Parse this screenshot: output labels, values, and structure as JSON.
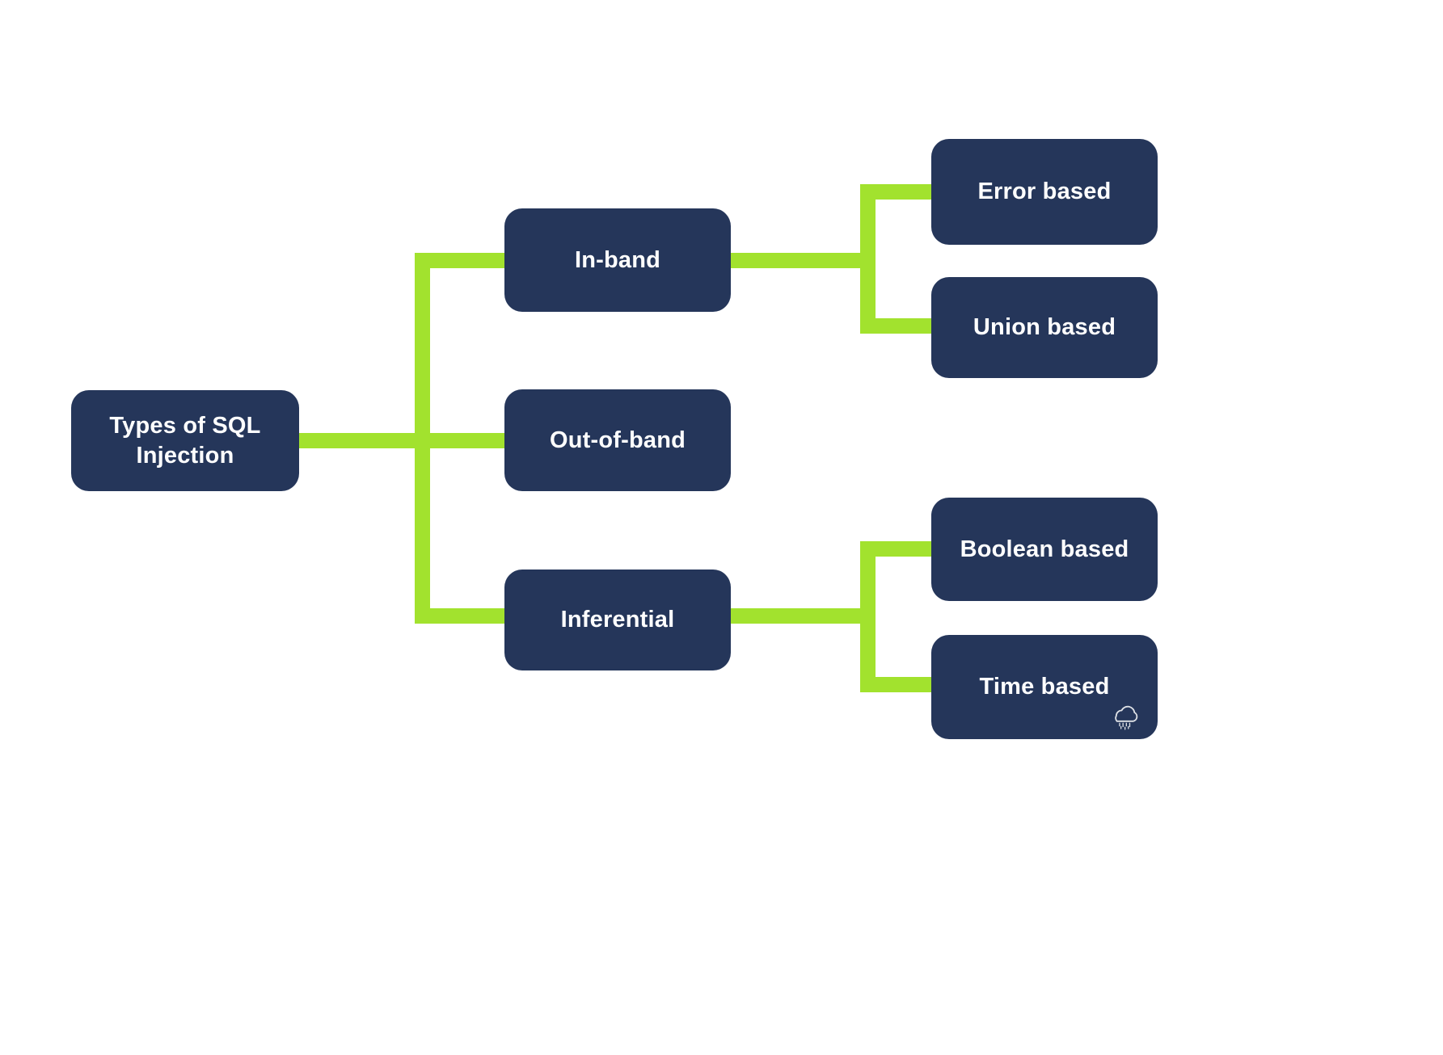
{
  "diagram": {
    "type": "tree-mindmap",
    "orientation": "left-to-right",
    "colors": {
      "node_fill": "#25365a",
      "node_text": "#ffffff",
      "connector": "#a2e22e",
      "background": "#ffffff"
    },
    "root": {
      "id": "types-of-sql-injection",
      "label": "Types of SQL\nInjection"
    },
    "branches": [
      {
        "id": "in-band",
        "label": "In-band",
        "children": [
          {
            "id": "error-based",
            "label": "Error based"
          },
          {
            "id": "union-based",
            "label": "Union based"
          }
        ]
      },
      {
        "id": "out-of-band",
        "label": "Out-of-band",
        "children": []
      },
      {
        "id": "inferential",
        "label": "Inferential",
        "children": [
          {
            "id": "boolean-based",
            "label": "Boolean based"
          },
          {
            "id": "time-based",
            "label": "Time based"
          }
        ]
      }
    ],
    "watermark": {
      "icon": "cloud-icon"
    }
  }
}
